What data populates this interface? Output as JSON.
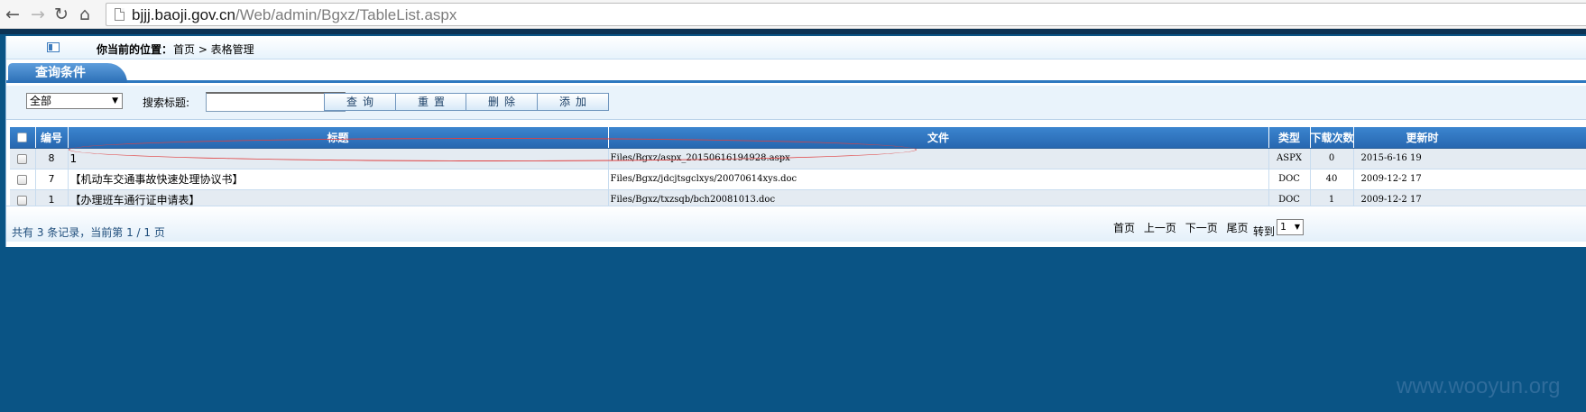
{
  "browser": {
    "url_host": "bjjj.baoji.gov.cn",
    "url_path": "/Web/admin/Bgxz/TableList.aspx",
    "back_icon": "arrow-left-icon",
    "forward_icon": "arrow-right-icon",
    "reload_icon": "reload-icon",
    "home_icon": "home-icon"
  },
  "location": {
    "label": "你当前的位置：",
    "path": "首页 > 表格管理"
  },
  "query_tab": {
    "label": "查询条件"
  },
  "filter": {
    "category_value": "全部",
    "search_label": "搜索标题:",
    "search_value": "",
    "buttons": {
      "search": "查询",
      "reset": "重置",
      "delete": "删除",
      "add": "添加"
    }
  },
  "table": {
    "columns": [
      "编号",
      "标题",
      "文件",
      "类型",
      "下载次数",
      "更新时"
    ],
    "rows": [
      {
        "id": "8",
        "title": "1",
        "file": "Files/Bgxz/aspx_20150616194928.aspx",
        "type": "ASPX",
        "downloads": "0",
        "updated": "2015-6-16 19"
      },
      {
        "id": "7",
        "title": "【机动车交通事故快速处理协议书】",
        "file": "Files/Bgxz/jdcjtsgclxys/20070614xys.doc",
        "type": "DOC",
        "downloads": "40",
        "updated": "2009-12-2 17"
      },
      {
        "id": "1",
        "title": "【办理班车通行证申请表】",
        "file": "Files/Bgxz/txzsqb/bch20081013.doc",
        "type": "DOC",
        "downloads": "1",
        "updated": "2009-12-2 17"
      }
    ]
  },
  "pager": {
    "record_info": "共有 3 条记录，当前第 1 / 1 页",
    "first": "首页",
    "prev": "上一页",
    "next": "下一页",
    "last": "尾页",
    "goto_label": "转到",
    "page_value": "1"
  },
  "watermark": "www.wooyun.org",
  "colors": {
    "background": "#0a5485",
    "header_blue": "#2767b0",
    "annotation_red": "#e04040"
  }
}
